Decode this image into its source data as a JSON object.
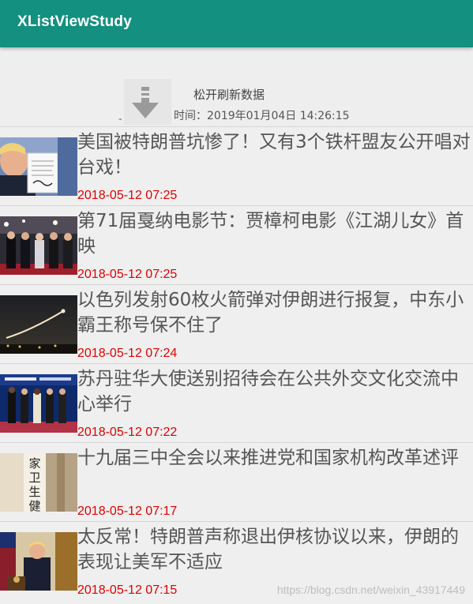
{
  "toolbar": {
    "title": "XListViewStudy",
    "color": "#13907f"
  },
  "refresh": {
    "status": "松开刷新数据",
    "time_label": "时间：2019年01月04日 14:26:15",
    "icon": "arrow-down-icon"
  },
  "news": [
    {
      "title": "美国被特朗普坑惨了！又有3个铁杆盟友公开唱对台戏！",
      "time": "2018-05-12 07:25"
    },
    {
      "title": "第71届戛纳电影节：贾樟柯电影《江湖儿女》首映",
      "time": "2018-05-12 07:25"
    },
    {
      "title": "以色列发射60枚火箭弹对伊朗进行报复，中东小霸王称号保不住了",
      "time": "2018-05-12 07:24"
    },
    {
      "title": "苏丹驻华大使送别招待会在公共外交文化交流中心举行",
      "time": "2018-05-12 07:22"
    },
    {
      "title": "十九届三中全会以来推进党和国家机构改革述评",
      "time": "2018-05-12 07:17"
    },
    {
      "title": "太反常！特朗普声称退出伊核协议以来，伊朗的表现让美军不适应",
      "time": "2018-05-12 07:15"
    }
  ],
  "thumb4_text": "家卫生健康",
  "watermark": "https://blog.csdn.net/weixin_43917449",
  "colors": {
    "time_text": "#e00000",
    "title_text": "#555555",
    "divider": "#d4d4d4"
  }
}
